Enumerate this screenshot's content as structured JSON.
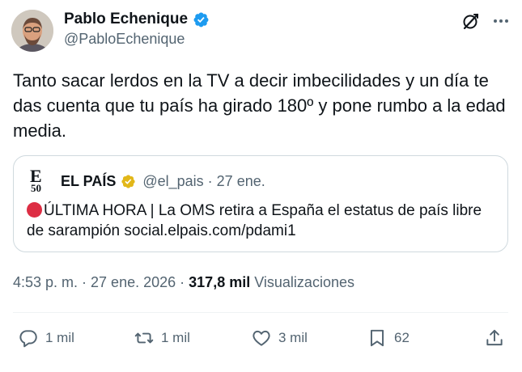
{
  "author": {
    "display_name": "Pablo Echenique",
    "handle": "@PabloEchenique",
    "avatar_icon": "profile-photo",
    "verified_icon": "blue-verified-badge"
  },
  "header_icons": [
    "grok-icon",
    "more-options-icon"
  ],
  "tweet": {
    "text": "Tanto sacar lerdos en la TV a decir imbecilidades y un día te das cuenta que tu país ha girado 180º y pone rumbo a la edad media."
  },
  "quoted_tweet": {
    "logo_letter": "E",
    "logo_number": "50",
    "name": "EL PAÍS",
    "badge_icon": "gold-verified-badge",
    "handle_date": "@el_pais · 27 ene.",
    "red_circle_icon": "red-circle-emoji",
    "body": "ÚLTIMA HORA | La OMS retira a España el estatus de país libre de sarampión social.elpais.com/pdami1"
  },
  "meta": {
    "time_date": "4:53 p. m. · 27 ene. 2026 ·",
    "views_count": "317,8 mil",
    "views_label": "Visualizaciones"
  },
  "actions": {
    "replies": "1 mil",
    "reposts": "1 mil",
    "likes": "3 mil",
    "bookmarks": "62"
  },
  "colors": {
    "text": "#0f1419",
    "secondary": "#536471",
    "verified_blue": "#1d9bf0",
    "gold": "#e2b719",
    "border": "#cfd9de"
  }
}
